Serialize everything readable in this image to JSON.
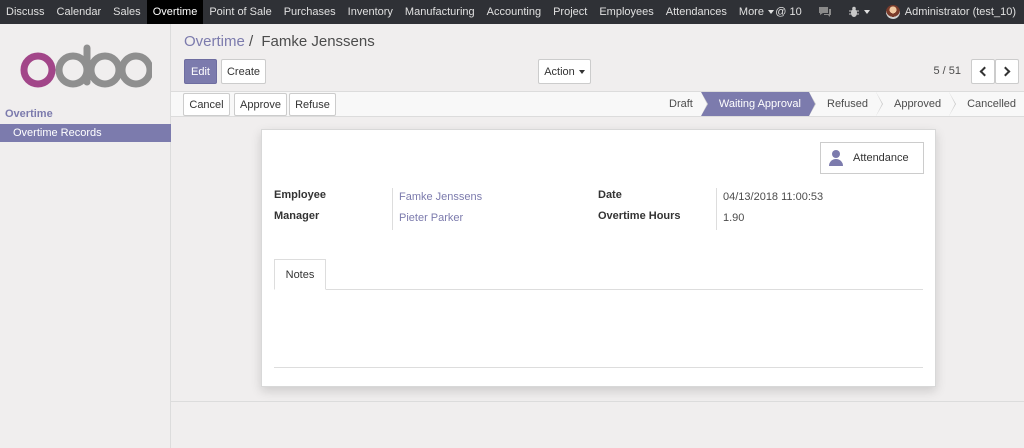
{
  "nav": {
    "items": [
      {
        "label": "Discuss"
      },
      {
        "label": "Calendar"
      },
      {
        "label": "Sales"
      },
      {
        "label": "Overtime",
        "active": true
      },
      {
        "label": "Point of Sale"
      },
      {
        "label": "Purchases"
      },
      {
        "label": "Inventory"
      },
      {
        "label": "Manufacturing"
      },
      {
        "label": "Accounting"
      },
      {
        "label": "Project"
      },
      {
        "label": "Employees"
      },
      {
        "label": "Attendances"
      }
    ],
    "more_label": "More",
    "messages_count": "@ 10",
    "user_label": "Administrator (test_10)"
  },
  "sidebar": {
    "logo_text": "odoo",
    "section": "Overtime",
    "item": "Overtime Records"
  },
  "breadcrumb": {
    "parent": "Overtime",
    "separator": "/",
    "current": "Famke Jenssens"
  },
  "toolbar": {
    "edit": "Edit",
    "create": "Create",
    "action": "Action",
    "pager": "5 / 51"
  },
  "statusbar": {
    "cancel": "Cancel",
    "approve": "Approve",
    "refuse": "Refuse",
    "stages": [
      "Draft",
      "Waiting Approval",
      "Refused",
      "Approved",
      "Cancelled"
    ],
    "active_stage": "Waiting Approval"
  },
  "form": {
    "smart_button": "Attendance",
    "employee_label": "Employee",
    "employee_value": "Famke Jenssens",
    "manager_label": "Manager",
    "manager_value": "Pieter Parker",
    "date_label": "Date",
    "date_value": "04/13/2018 11:00:53",
    "hours_label": "Overtime Hours",
    "hours_value": "1.90",
    "tab_notes": "Notes"
  },
  "colors": {
    "brand": "#7c7bad",
    "topbar": "#2f3136"
  }
}
